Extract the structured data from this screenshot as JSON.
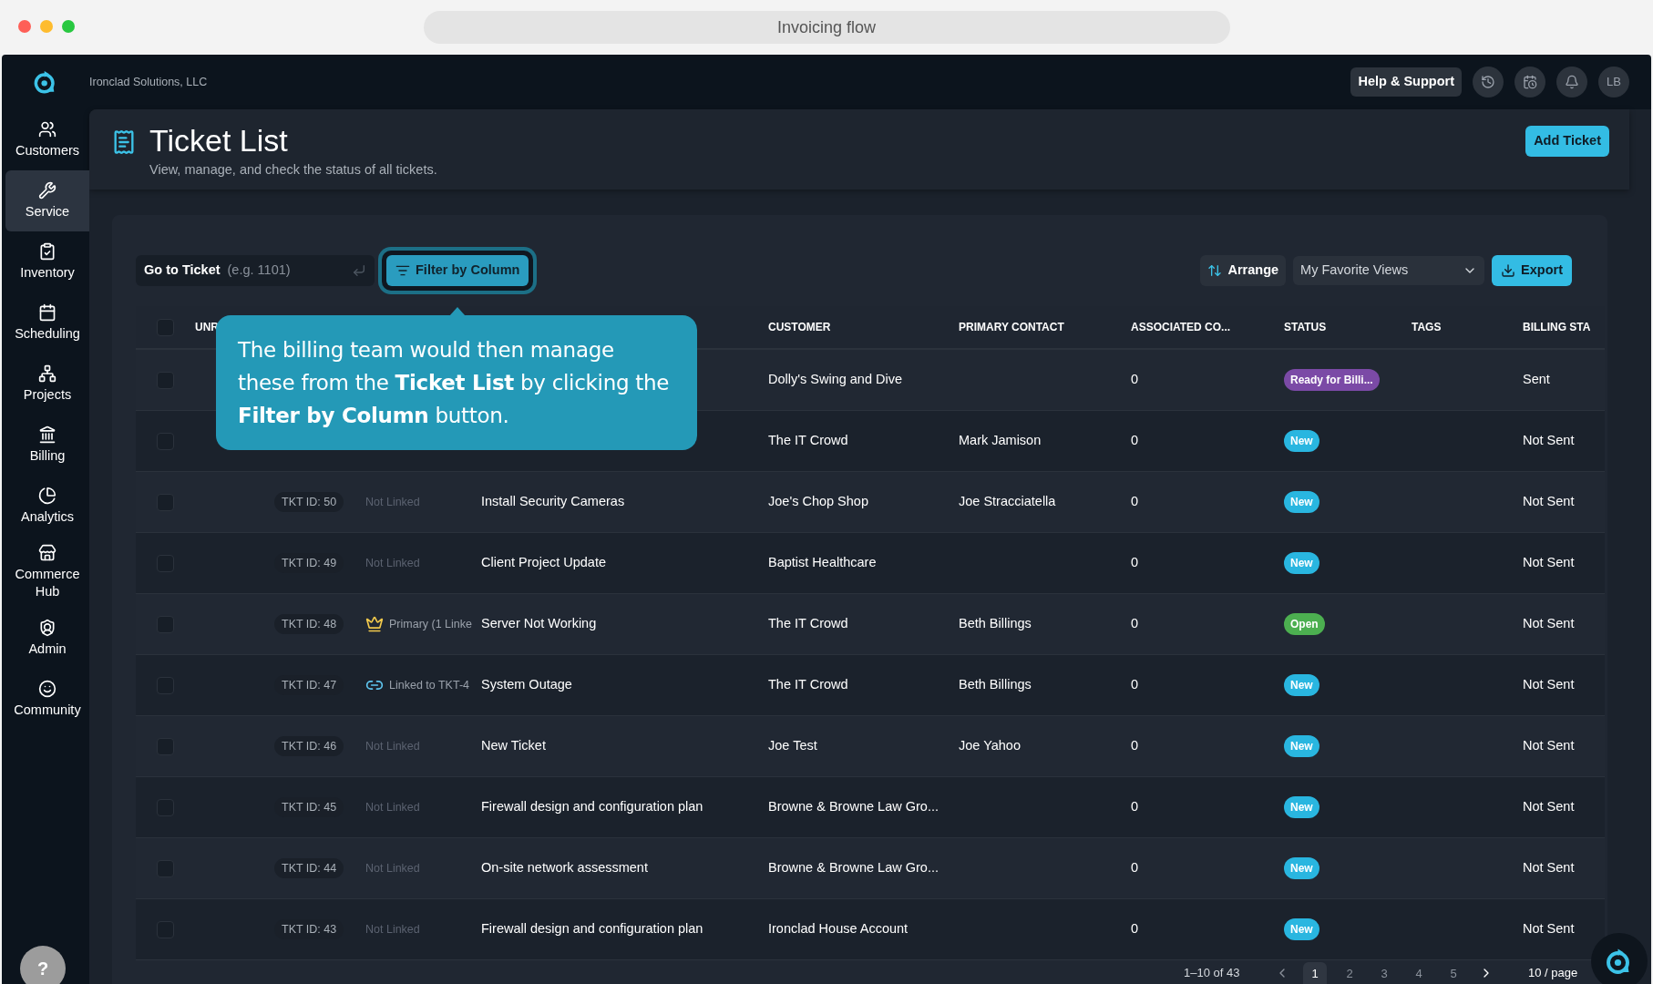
{
  "browser": {
    "address": "Invoicing flow"
  },
  "topbar": {
    "company": "Ironclad Solutions, LLC",
    "help_button": "Help & Support",
    "avatar": "LB"
  },
  "sidebar": {
    "items": [
      {
        "label": "Customers",
        "selected": false
      },
      {
        "label": "Service",
        "selected": true
      },
      {
        "label": "Inventory",
        "selected": false
      },
      {
        "label": "Scheduling",
        "selected": false
      },
      {
        "label": "Projects",
        "selected": false
      },
      {
        "label": "Billing",
        "selected": false
      },
      {
        "label": "Analytics",
        "selected": false
      },
      {
        "label": "Commerce Hub",
        "selected": false
      },
      {
        "label": "Admin",
        "selected": false
      },
      {
        "label": "Community",
        "selected": false
      }
    ],
    "help": "?"
  },
  "header": {
    "title": "Ticket List",
    "subtitle": "View, manage, and check the status of all tickets.",
    "add_button": "Add Ticket"
  },
  "toolbar": {
    "goto_label": "Go to Ticket",
    "goto_placeholder": "(e.g. 1101)",
    "filter_button": {
      "label": "Filter by Column",
      "highlighted": true
    },
    "arrange_button": "Arrange",
    "views_select": "My Favorite Views",
    "export_button": "Export"
  },
  "tooltip": "The billing team would then manage these from the **Ticket List** by clicking the **Filter by Column** button.",
  "table": {
    "select_all": {
      "checked": false
    },
    "columns": [
      "UNR",
      "CUSTOMER",
      "PRIMARY CONTACT",
      "ASSOCIATED CO...",
      "STATUS",
      "TAGS",
      "BILLING STA"
    ],
    "rows": [
      {
        "checked": false,
        "customer": "Dolly's Swing and Dive",
        "associated": "0",
        "status": {
          "label": "Ready for Billi...",
          "color": "#7b4aa6"
        },
        "billing": "Sent"
      },
      {
        "checked": false,
        "customer": "The IT Crowd",
        "contact": "Mark Jamison",
        "associated": "0",
        "status": {
          "label": "New",
          "color": "#29b6e0"
        },
        "billing": "Not Sent"
      },
      {
        "checked": false,
        "ticket_id": "TKT ID: 50",
        "link": {
          "kind": "none",
          "text": "Not Linked"
        },
        "title": "Install Security Cameras",
        "customer": "Joe's Chop Shop",
        "contact": "Joe Stracciatella",
        "associated": "0",
        "status": {
          "label": "New",
          "color": "#29b6e0"
        },
        "billing": "Not Sent"
      },
      {
        "checked": false,
        "ticket_id": "TKT ID: 49",
        "link": {
          "kind": "none",
          "text": "Not Linked"
        },
        "title": "Client Project Update",
        "customer": "Baptist Healthcare",
        "associated": "0",
        "status": {
          "label": "New",
          "color": "#29b6e0"
        },
        "billing": "Not Sent"
      },
      {
        "checked": false,
        "ticket_id": "TKT ID: 48",
        "link": {
          "kind": "primary",
          "text": "Primary (1 Linke"
        },
        "title": "Server Not Working",
        "customer": "The IT Crowd",
        "contact": "Beth Billings",
        "associated": "0",
        "status": {
          "label": "Open",
          "color": "#4caf50"
        },
        "billing": "Not Sent"
      },
      {
        "checked": false,
        "ticket_id": "TKT ID: 47",
        "link": {
          "kind": "linked",
          "text": "Linked to TKT-4"
        },
        "title": "System Outage",
        "customer": "The IT Crowd",
        "contact": "Beth Billings",
        "associated": "0",
        "status": {
          "label": "New",
          "color": "#29b6e0"
        },
        "billing": "Not Sent"
      },
      {
        "checked": false,
        "ticket_id": "TKT ID: 46",
        "link": {
          "kind": "none",
          "text": "Not Linked"
        },
        "title": "New Ticket",
        "customer": "Joe Test",
        "contact": "Joe Yahoo",
        "associated": "0",
        "status": {
          "label": "New",
          "color": "#29b6e0"
        },
        "billing": "Not Sent"
      },
      {
        "checked": false,
        "ticket_id": "TKT ID: 45",
        "link": {
          "kind": "none",
          "text": "Not Linked"
        },
        "title": "Firewall design and configuration plan",
        "customer": "Browne & Browne Law Gro...",
        "associated": "0",
        "status": {
          "label": "New",
          "color": "#29b6e0"
        },
        "billing": "Not Sent"
      },
      {
        "checked": false,
        "ticket_id": "TKT ID: 44",
        "link": {
          "kind": "none",
          "text": "Not Linked"
        },
        "title": "On-site network assessment",
        "customer": "Browne & Browne Law Gro...",
        "associated": "0",
        "status": {
          "label": "New",
          "color": "#29b6e0"
        },
        "billing": "Not Sent"
      },
      {
        "checked": false,
        "ticket_id": "TKT ID: 43",
        "link": {
          "kind": "none",
          "text": "Not Linked"
        },
        "title": "Firewall design and configuration plan",
        "customer": "Ironclad House Account",
        "associated": "0",
        "status": {
          "label": "New",
          "color": "#29b6e0"
        },
        "billing": "Not Sent"
      }
    ]
  },
  "pagination": {
    "range": "1–10 of 43",
    "pages": [
      {
        "label": "1",
        "selected": true
      },
      {
        "label": "2",
        "selected": false
      },
      {
        "label": "3",
        "selected": false
      },
      {
        "label": "4",
        "selected": false
      },
      {
        "label": "5",
        "selected": false
      }
    ],
    "page_size": "10 / page"
  }
}
